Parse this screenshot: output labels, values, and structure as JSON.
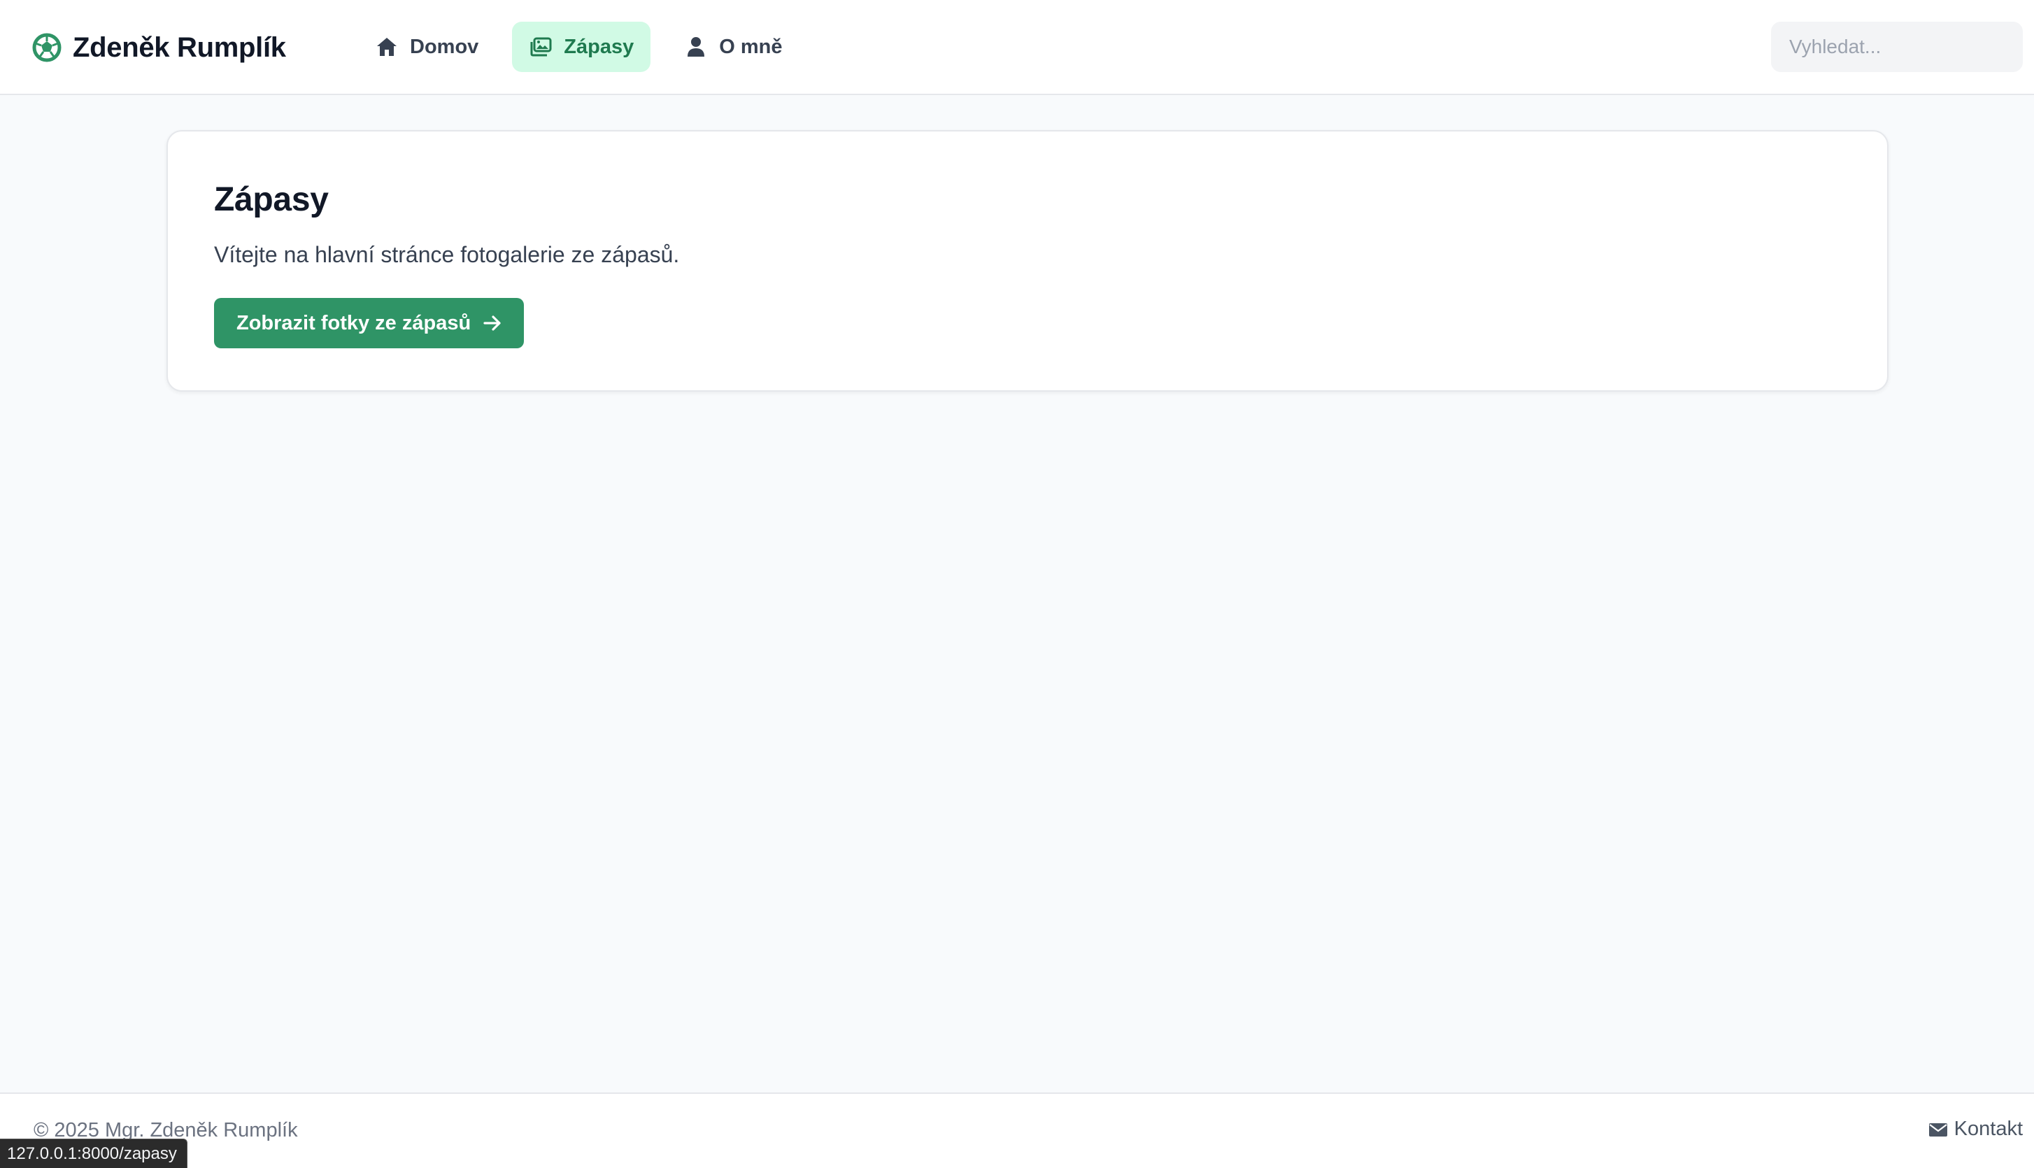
{
  "header": {
    "brand": {
      "name": "Zdeněk Rumplík",
      "icon": "soccer-ball-icon"
    },
    "nav": [
      {
        "label": "Domov",
        "icon": "home-icon",
        "active": false
      },
      {
        "label": "Zápasy",
        "icon": "images-icon",
        "active": true
      },
      {
        "label": "O mně",
        "icon": "user-icon",
        "active": false
      }
    ],
    "search": {
      "placeholder": "Vyhledat...",
      "value": ""
    }
  },
  "main": {
    "title": "Zápasy",
    "text": "Vítejte na hlavní stránce fotogalerie ze zápasů.",
    "button_label": "Zobrazit fotky ze zápasů",
    "button_icon": "arrow-right-icon"
  },
  "footer": {
    "copyright": "© 2025 Mgr. Zdeněk Rumplík",
    "contact_label": "Kontakt",
    "contact_icon": "envelope-icon"
  },
  "browser": {
    "status_url": "127.0.0.1:8000/zapasy"
  },
  "colors": {
    "accent": "#2f9466",
    "active_nav_bg": "#d1fae5",
    "active_nav_text": "#1f7a4f",
    "page_bg": "#f8fafc"
  }
}
